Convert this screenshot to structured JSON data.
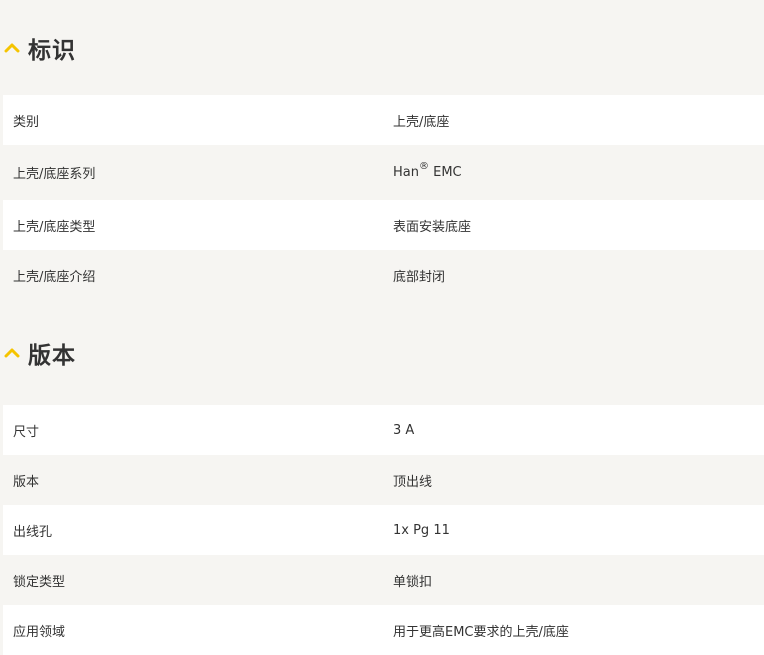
{
  "sections": [
    {
      "title": "标识",
      "rows": [
        {
          "label": "类别",
          "value": "上壳/底座"
        },
        {
          "label": "上壳/底座系列",
          "value_main": "Han",
          "value_sup": "®",
          "value_tail": " EMC"
        },
        {
          "label": "上壳/底座类型",
          "value": "表面安装底座"
        },
        {
          "label": "上壳/底座介绍",
          "value": "底部封闭"
        }
      ]
    },
    {
      "title": "版本",
      "rows": [
        {
          "label": "尺寸",
          "value": "3 A"
        },
        {
          "label": "版本",
          "value": "顶出线"
        },
        {
          "label": "出线孔",
          "value": "1x Pg 11"
        },
        {
          "label": "锁定类型",
          "value": "单锁扣"
        },
        {
          "label": "应用领域",
          "value": "用于更高EMC要求的上壳/底座"
        }
      ]
    }
  ],
  "colors": {
    "chevron": "#f5c400",
    "row_white": "#ffffff",
    "row_grey": "#f6f5f2",
    "text": "#333333"
  },
  "icons": {
    "section_toggle": "chevron-up-icon"
  }
}
